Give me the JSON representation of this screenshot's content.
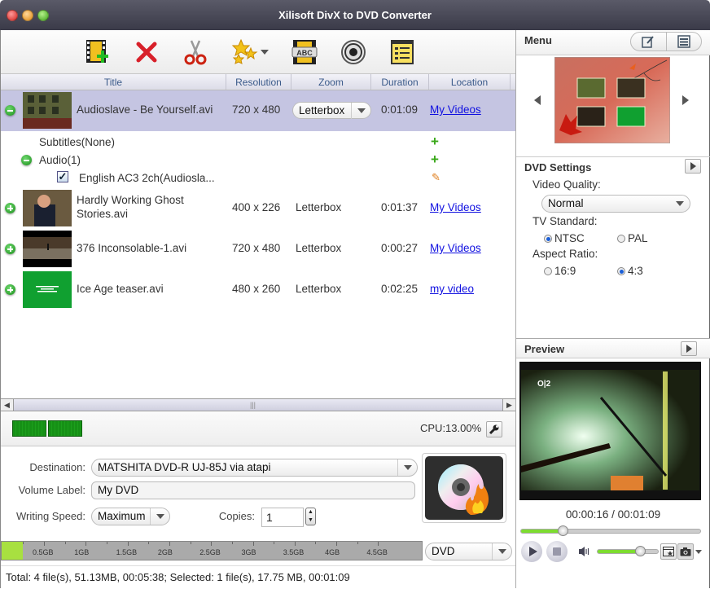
{
  "window": {
    "title": "Xilisoft DivX to DVD Converter"
  },
  "toolbar": {
    "items": [
      {
        "name": "add-file",
        "icon": "film-add-icon"
      },
      {
        "name": "remove",
        "icon": "red-x-icon"
      },
      {
        "name": "clip",
        "icon": "scissors-icon"
      },
      {
        "name": "effects",
        "icon": "stars-icon"
      },
      {
        "name": "subtitle",
        "icon": "film-abc-icon"
      },
      {
        "name": "burn",
        "icon": "record-icon"
      },
      {
        "name": "task-list",
        "icon": "list-icon"
      }
    ]
  },
  "grid": {
    "columns": [
      "Title",
      "Resolution",
      "Zoom",
      "Duration",
      "Location"
    ],
    "files": [
      {
        "title": "Audioslave - Be Yourself.avi",
        "resolution": "720 x 480",
        "zoom": "Letterbox",
        "duration": "0:01:09",
        "location": "My Videos",
        "selected": true,
        "expanded": true
      },
      {
        "title": "Hardly Working  Ghost Stories.avi",
        "title_line1": "Hardly Working  Ghost",
        "title_line2": "Stories.avi",
        "resolution": "400 x 226",
        "zoom": "Letterbox",
        "duration": "0:01:37",
        "location": "My Videos"
      },
      {
        "title": "376 Inconsolable-1.avi",
        "resolution": "720 x 480",
        "zoom": "Letterbox",
        "duration": "0:00:27",
        "location": "My Videos"
      },
      {
        "title": "Ice Age teaser.avi",
        "resolution": "480 x 260",
        "zoom": "Letterbox",
        "duration": "0:02:25",
        "location": "my video"
      }
    ],
    "subtitles_label": "Subtitles(None)",
    "audio_label": "Audio(1)",
    "audio_track": "English AC3 2ch(Audiosla..."
  },
  "cpu": {
    "label": "CPU:13.00%"
  },
  "output": {
    "destination_label": "Destination:",
    "destination_value": "MATSHITA DVD-R UJ-85J via atapi",
    "volume_label_label": "Volume Label:",
    "volume_label_value": "My DVD",
    "writing_speed_label": "Writing Speed:",
    "writing_speed_value": "Maximum",
    "copies_label": "Copies:",
    "copies_value": "1"
  },
  "capacity": {
    "ticks": [
      "0.5GB",
      "1GB",
      "1.5GB",
      "2GB",
      "2.5GB",
      "3GB",
      "3.5GB",
      "4GB",
      "4.5GB"
    ],
    "used_fraction": 0.05,
    "disc_type": "DVD"
  },
  "status": {
    "text": "Total: 4 file(s), 51.13MB,  00:05:38; Selected: 1 file(s), 17.75 MB,  00:01:09"
  },
  "menu_panel": {
    "title": "Menu"
  },
  "dvd_settings": {
    "title": "DVD Settings",
    "video_quality_label": "Video Quality:",
    "video_quality_value": "Normal",
    "tv_standard_label": "TV Standard:",
    "tv_options": [
      "NTSC",
      "PAL"
    ],
    "tv_selected": "NTSC",
    "aspect_ratio_label": "Aspect Ratio:",
    "aspect_options": [
      "16:9",
      "4:3"
    ],
    "aspect_selected": "4:3"
  },
  "preview": {
    "title": "Preview",
    "time": "00:00:16 / 00:01:09",
    "progress_fraction": 0.23,
    "volume_fraction": 0.7
  },
  "colors": {
    "selection": "#c5c5e2",
    "link": "#1010e0",
    "progress": "#7ddc30",
    "capacity": "#a8e040"
  }
}
